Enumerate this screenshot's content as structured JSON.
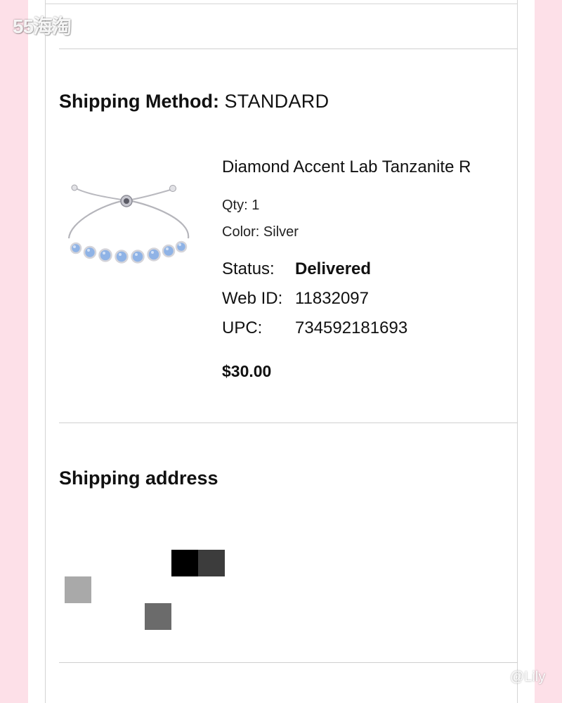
{
  "watermark": {
    "site_logo": "55海淘",
    "user_tag": "@Lily"
  },
  "shipping_method": {
    "label": "Shipping Method:",
    "value": "STANDARD"
  },
  "product": {
    "name": "Diamond Accent Lab Tanzanite R",
    "image_icon": "bracelet-image",
    "qty": "Qty: 1",
    "color": "Color: Silver",
    "details": [
      {
        "key": "Status:",
        "value": "Delivered"
      },
      {
        "key": "Web ID:",
        "value": "11832097"
      },
      {
        "key": "UPC:",
        "value": "734592181693"
      }
    ],
    "price": "$30.00"
  },
  "shipping_address": {
    "title": "Shipping address"
  },
  "colors": {
    "background_pink": "#fde0e8",
    "divider": "#cfcfcf",
    "gem_blue": "#8fb3e6"
  }
}
